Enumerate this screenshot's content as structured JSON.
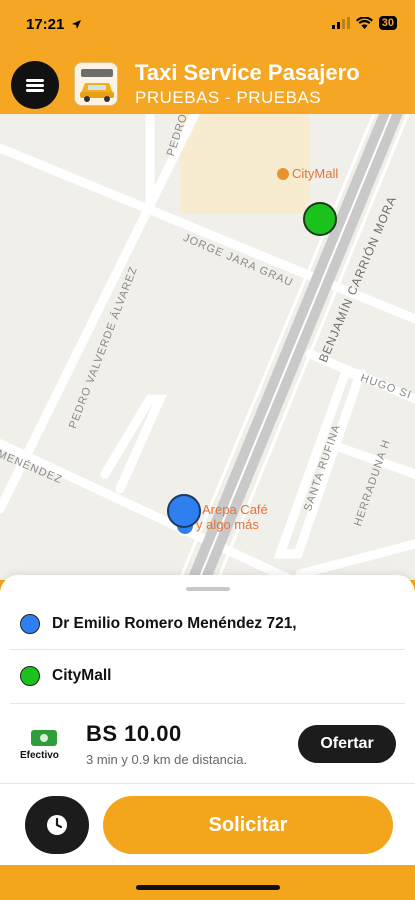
{
  "status_bar": {
    "time": "17:21",
    "battery": "30"
  },
  "header": {
    "title": "Taxi Service Pasajero",
    "subtitle": "PRUEBAS - PRUEBAS"
  },
  "map": {
    "streets": {
      "pedro_va": "PEDRO VA",
      "jorge_jara_grau": "JORGE JARA GRAU",
      "benjamin_carrion_mora": "BENJAMÍN CARRIÓN MORA",
      "pedro_valverde_alvarez": "PEDRO VALVERDE ÁLVAREZ",
      "hugo_s": "HUGO SI",
      "menendez": "MENÉNDEZ",
      "santa_rufina": "SANTA RUFINA",
      "herraduna_h": "HERRADUNA H"
    },
    "pois": {
      "citymall": "CityMall",
      "arepa_line1": "Arepa Café",
      "arepa_line2": "y algo más"
    },
    "colors": {
      "origin": "#2f7ff0",
      "destination": "#1cc21c"
    }
  },
  "trip": {
    "origin": "Dr Emilio Romero Menéndez 721,",
    "destination": "CityMall",
    "payment_label": "Efectivo",
    "price": "BS 10.00",
    "eta": "3 min y 0.9 km de distancia.",
    "offer_label": "Ofertar",
    "request_label": "Solicitar"
  },
  "icons": [
    "menu-icon",
    "clock-icon",
    "cash-icon",
    "location-arrow-icon",
    "wifi-icon",
    "signal-icon"
  ],
  "accent_color": "#f5a623"
}
